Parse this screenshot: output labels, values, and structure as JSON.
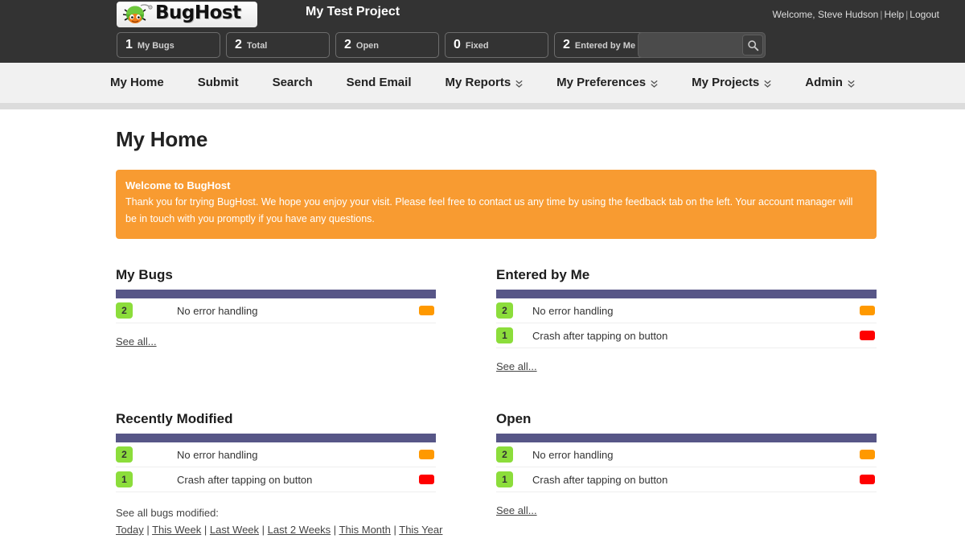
{
  "header": {
    "logo_text": "BugHost",
    "logo_icon": "bug-logo-icon",
    "project_title": "My Test Project",
    "welcome_text": "Welcome, Steve Hudson",
    "help_label": "Help",
    "logout_label": "Logout",
    "separator": "|",
    "stats": [
      {
        "num": "1",
        "label": "My Bugs"
      },
      {
        "num": "2",
        "label": "Total"
      },
      {
        "num": "2",
        "label": "Open"
      },
      {
        "num": "0",
        "label": "Fixed"
      },
      {
        "num": "2",
        "label": "Entered by Me"
      }
    ],
    "search": {
      "value": "",
      "placeholder": "",
      "icon": "search-icon"
    }
  },
  "nav": {
    "items": [
      {
        "label": "My Home",
        "caret": false
      },
      {
        "label": "Submit",
        "caret": false
      },
      {
        "label": "Search",
        "caret": false
      },
      {
        "label": "Send Email",
        "caret": false
      },
      {
        "label": "My Reports",
        "caret": true
      },
      {
        "label": "My Preferences",
        "caret": true
      },
      {
        "label": "My Projects",
        "caret": true
      },
      {
        "label": "Admin",
        "caret": true
      }
    ]
  },
  "page": {
    "title": "My Home",
    "banner": {
      "title": "Welcome to BugHost",
      "body": "Thank you for trying BugHost. We hope you enjoy your visit. Please feel free to contact us any time by using the feedback tab on the left. Your account manager will be in touch with you promptly if you have any questions.",
      "color": "#f89b31"
    },
    "panels": {
      "my_bugs": {
        "title": "My Bugs",
        "see_all": "See all...",
        "rows": [
          {
            "id": "2",
            "title": "No error handling",
            "status_color": "#ff9900"
          }
        ]
      },
      "entered_by_me": {
        "title": "Entered by Me",
        "see_all": "See all...",
        "rows": [
          {
            "id": "2",
            "title": "No error handling",
            "status_color": "#ff9900"
          },
          {
            "id": "1",
            "title": "Crash after tapping on button",
            "status_color": "#ff0000"
          }
        ]
      },
      "recently_modified": {
        "title": "Recently Modified",
        "modified_lead": "See all bugs modified:",
        "modified_links": [
          "Today",
          "This Week",
          "Last Week",
          "Last 2 Weeks",
          "This Month",
          "This Year"
        ],
        "rows": [
          {
            "id": "2",
            "title": "No error handling",
            "status_color": "#ff9900"
          },
          {
            "id": "1",
            "title": "Crash after tapping on button",
            "status_color": "#ff0000"
          }
        ]
      },
      "open": {
        "title": "Open",
        "see_all": "See all...",
        "rows": [
          {
            "id": "2",
            "title": "No error handling",
            "status_color": "#ff9900"
          },
          {
            "id": "1",
            "title": "Crash after tapping on button",
            "status_color": "#ff0000"
          }
        ]
      }
    }
  },
  "colors": {
    "topbar_bg": "#333333",
    "nav_bg": "#f1f1f1",
    "panel_bar": "#575687",
    "badge_green": "#8cdd3b",
    "status_orange": "#ff9900",
    "status_red": "#ff0000"
  }
}
